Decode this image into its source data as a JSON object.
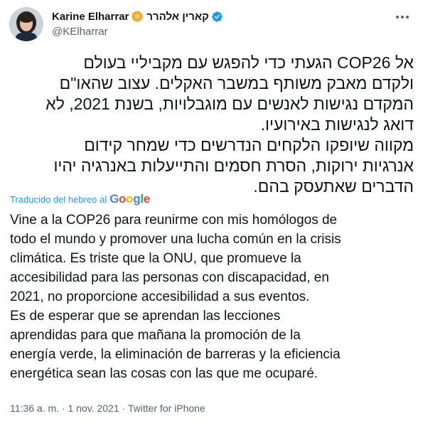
{
  "author": {
    "display_name": "Karine Elharrar",
    "hebrew_name": "קארין אלהרר",
    "handle": "@KElharrar"
  },
  "tweet": {
    "hebrew_text": "אל COP26 הגעתי כדי להפגש עם מקביליי בעולם\nולקדם מאבק משותף במשבר האקלים. עצוב שהאו\"ם\nהמקדם נגישות לאנשים עם מוגבלויות, בשנת 2021, לא\nדואג לנגישות באירועיו.\nמקווה שיופקו הלקחים הנדרשים כדי שמחר קידום\nאנרגיות ירוקות, הסרת חסמים והתייעלות באנרגיה יהיו\nהדברים שאתעסק בהם.",
    "translated_label": "Traducido del hebreo al",
    "translation_provider": "Google",
    "translated_text": "Vine a la COP26 para reunirme con mis homólogos de\ntodo el mundo y promover una lucha común en la crisis\nclimática. Es triste que la ONU, que promueve la\naccesibilidad para las personas con discapacidad, en\n2021, no proporcione accesibilidad a sus eventos.\n Es de esperar que se aprendan las lecciones\naprendidas para que mañana la promoción de la\nenergía verde, la eliminación de barreras y la eficiencia\nenergética sean las cosas con las que me ocuparé."
  },
  "meta": {
    "time": "11:36 a. m.",
    "separator": "·",
    "date": "1 nov. 2021",
    "source": "Twitter for iPhone"
  },
  "colors": {
    "accent": "#1d9bf0",
    "secondary_text": "#536471",
    "org_badge": "#f5a623"
  },
  "icons": {
    "more": "more-dots-icon",
    "verified": "verified-badge-icon",
    "org": "org-badge-icon"
  }
}
